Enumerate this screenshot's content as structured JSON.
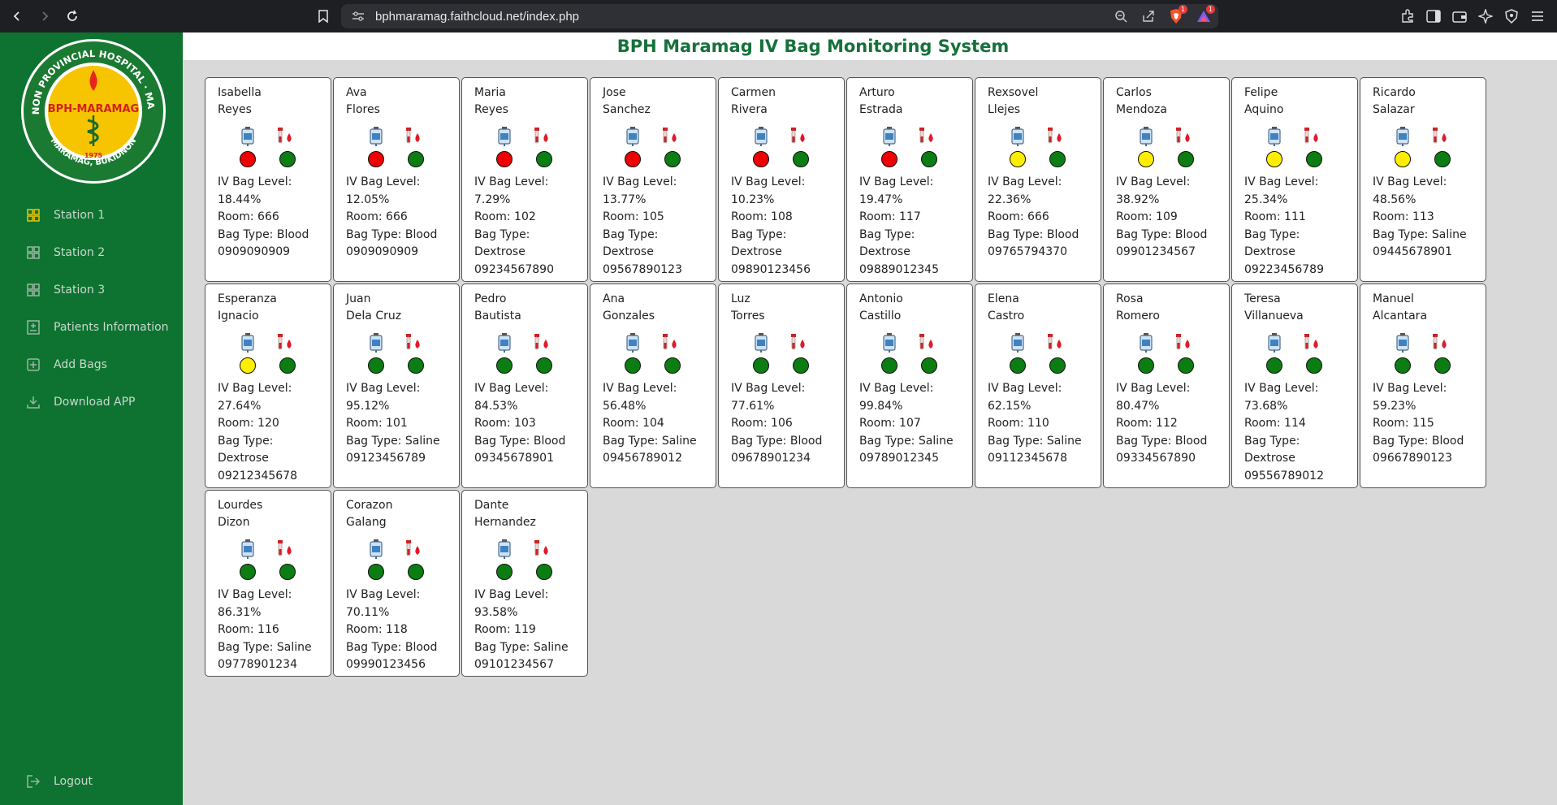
{
  "browser": {
    "url": "bphmaramag.faithcloud.net/index.php",
    "badge1": "1",
    "badge2": "1"
  },
  "logo": {
    "top_text": "BUKIDNON PROVINCIAL HOSPITAL · MARAMAG",
    "center_text": "BPH-MARAMAG",
    "year": "1975",
    "bottom_text": "MARAMAG, BUKIDNON"
  },
  "sidebar": {
    "items": [
      {
        "label": "Station 1",
        "icon": "grid-icon"
      },
      {
        "label": "Station 2",
        "icon": "grid-icon"
      },
      {
        "label": "Station 3",
        "icon": "grid-icon"
      },
      {
        "label": "Patients Information",
        "icon": "hospital-bed-icon"
      },
      {
        "label": "Add Bags",
        "icon": "plus-square-icon"
      },
      {
        "label": "Download APP",
        "icon": "download-icon"
      }
    ],
    "logout": "Logout"
  },
  "header": {
    "title": "BPH Maramag IV Bag Monitoring System"
  },
  "colors": {
    "red": "#ee0000",
    "yellow": "#ffee00",
    "green": "#0b7d12",
    "sidebar": "#0e7330"
  },
  "labels": {
    "level": "IV Bag Level:",
    "room": "Room:",
    "type": "Bag Type:"
  },
  "patients": [
    {
      "first": "Isabella",
      "last": "Reyes",
      "level": "18.44%",
      "room": "666",
      "type": "Blood",
      "phone": "0909090909",
      "s1": "red",
      "s2": "green"
    },
    {
      "first": "Ava",
      "last": "Flores",
      "level": "12.05%",
      "room": "666",
      "type": "Blood",
      "phone": "0909090909",
      "s1": "red",
      "s2": "green"
    },
    {
      "first": "Maria",
      "last": "Reyes",
      "level": "7.29%",
      "room": "102",
      "type": "Dextrose",
      "phone": "09234567890",
      "s1": "red",
      "s2": "green"
    },
    {
      "first": "Jose",
      "last": "Sanchez",
      "level": "13.77%",
      "room": "105",
      "type": "Dextrose",
      "phone": "09567890123",
      "s1": "red",
      "s2": "green"
    },
    {
      "first": "Carmen",
      "last": "Rivera",
      "level": "10.23%",
      "room": "108",
      "type": "Dextrose",
      "phone": "09890123456",
      "s1": "red",
      "s2": "green"
    },
    {
      "first": "Arturo",
      "last": "Estrada",
      "level": "19.47%",
      "room": "117",
      "type": "Dextrose",
      "phone": "09889012345",
      "s1": "red",
      "s2": "green"
    },
    {
      "first": "Rexsovel",
      "last": "Llejes",
      "level": "22.36%",
      "room": "666",
      "type": "Blood",
      "phone": "09765794370",
      "s1": "yellow",
      "s2": "green"
    },
    {
      "first": "Carlos",
      "last": "Mendoza",
      "level": "38.92%",
      "room": "109",
      "type": "Blood",
      "phone": "09901234567",
      "s1": "yellow",
      "s2": "green"
    },
    {
      "first": "Felipe",
      "last": "Aquino",
      "level": "25.34%",
      "room": "111",
      "type": "Dextrose",
      "phone": "09223456789",
      "s1": "yellow",
      "s2": "green"
    },
    {
      "first": "Ricardo",
      "last": "Salazar",
      "level": "48.56%",
      "room": "113",
      "type": "Saline",
      "phone": "09445678901",
      "s1": "yellow",
      "s2": "green"
    },
    {
      "first": "Esperanza",
      "last": "Ignacio",
      "level": "27.64%",
      "room": "120",
      "type": "Dextrose",
      "phone": "09212345678",
      "s1": "yellow",
      "s2": "green"
    },
    {
      "first": "Juan",
      "last": "Dela Cruz",
      "level": "95.12%",
      "room": "101",
      "type": "Saline",
      "phone": "09123456789",
      "s1": "green",
      "s2": "green"
    },
    {
      "first": "Pedro",
      "last": "Bautista",
      "level": "84.53%",
      "room": "103",
      "type": "Blood",
      "phone": "09345678901",
      "s1": "green",
      "s2": "green"
    },
    {
      "first": "Ana",
      "last": "Gonzales",
      "level": "56.48%",
      "room": "104",
      "type": "Saline",
      "phone": "09456789012",
      "s1": "green",
      "s2": "green"
    },
    {
      "first": "Luz",
      "last": "Torres",
      "level": "77.61%",
      "room": "106",
      "type": "Blood",
      "phone": "09678901234",
      "s1": "green",
      "s2": "green"
    },
    {
      "first": "Antonio",
      "last": "Castillo",
      "level": "99.84%",
      "room": "107",
      "type": "Saline",
      "phone": "09789012345",
      "s1": "green",
      "s2": "green"
    },
    {
      "first": "Elena",
      "last": "Castro",
      "level": "62.15%",
      "room": "110",
      "type": "Saline",
      "phone": "09112345678",
      "s1": "green",
      "s2": "green"
    },
    {
      "first": "Rosa",
      "last": "Romero",
      "level": "80.47%",
      "room": "112",
      "type": "Blood",
      "phone": "09334567890",
      "s1": "green",
      "s2": "green"
    },
    {
      "first": "Teresa",
      "last": "Villanueva",
      "level": "73.68%",
      "room": "114",
      "type": "Dextrose",
      "phone": "09556789012",
      "s1": "green",
      "s2": "green"
    },
    {
      "first": "Manuel",
      "last": "Alcantara",
      "level": "59.23%",
      "room": "115",
      "type": "Blood",
      "phone": "09667890123",
      "s1": "green",
      "s2": "green"
    },
    {
      "first": "Lourdes",
      "last": "Dizon",
      "level": "86.31%",
      "room": "116",
      "type": "Saline",
      "phone": "09778901234",
      "s1": "green",
      "s2": "green"
    },
    {
      "first": "Corazon",
      "last": "Galang",
      "level": "70.11%",
      "room": "118",
      "type": "Blood",
      "phone": "09990123456",
      "s1": "green",
      "s2": "green"
    },
    {
      "first": "Dante",
      "last": "Hernandez",
      "level": "93.58%",
      "room": "119",
      "type": "Saline",
      "phone": "09101234567",
      "s1": "green",
      "s2": "green"
    }
  ]
}
